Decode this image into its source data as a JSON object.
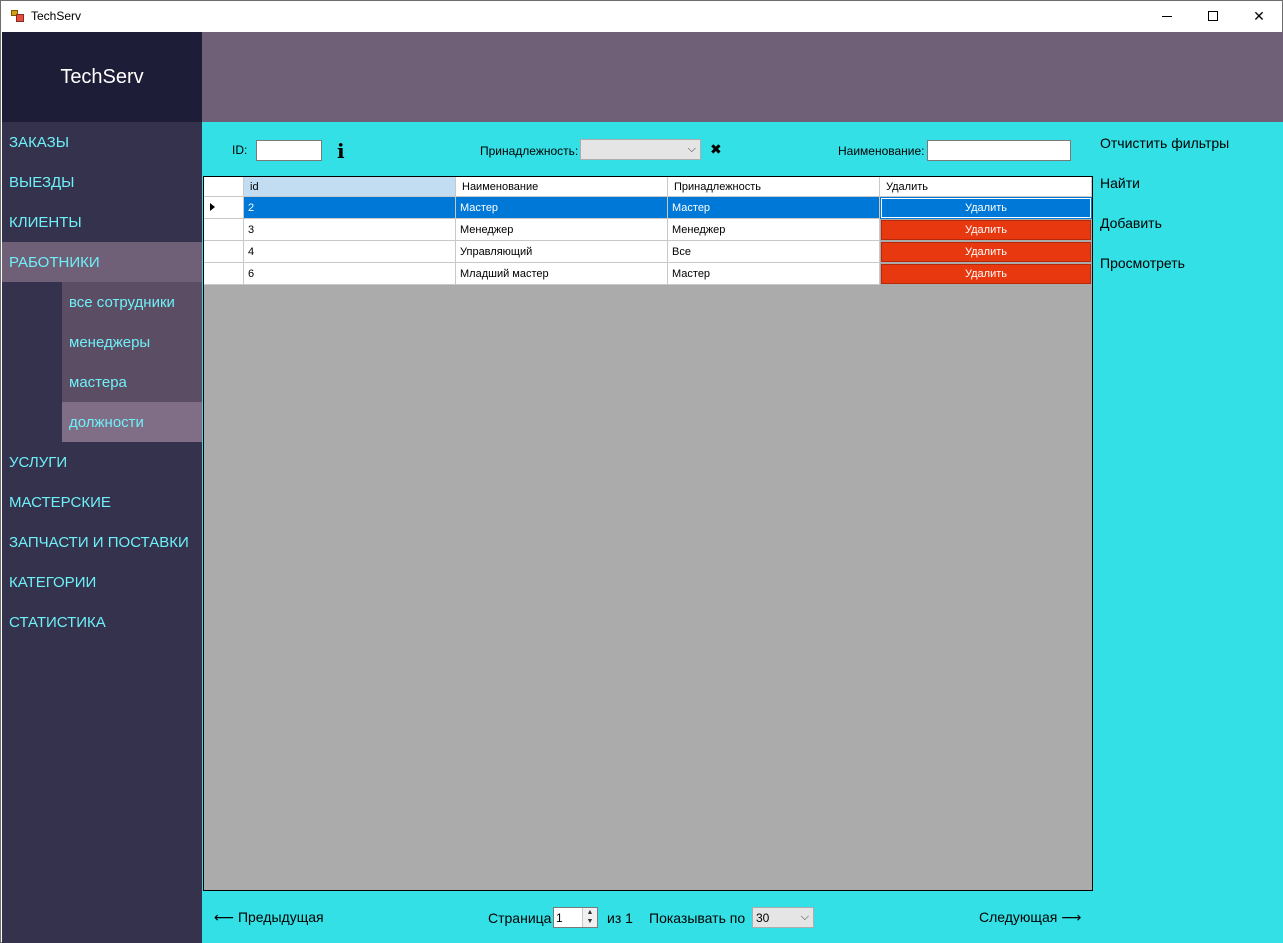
{
  "window": {
    "title": "TechServ",
    "controls": {
      "minimize": "minimize-icon",
      "maximize": "maximize-icon",
      "close": "close-icon"
    }
  },
  "sidebar": {
    "logo": "TechServ",
    "items": [
      {
        "label": "ЗАКАЗЫ",
        "active": false
      },
      {
        "label": "ВЫЕЗДЫ",
        "active": false
      },
      {
        "label": "КЛИЕНТЫ",
        "active": false
      },
      {
        "label": "РАБОТНИКИ",
        "active": true
      },
      {
        "label": "УСЛУГИ",
        "active": false
      },
      {
        "label": "МАСТЕРСКИЕ",
        "active": false
      },
      {
        "label": "ЗАПЧАСТИ И ПОСТАВКИ",
        "active": false
      },
      {
        "label": "КАТЕГОРИИ",
        "active": false
      },
      {
        "label": "СТАТИСТИКА",
        "active": false
      }
    ],
    "subitems": [
      {
        "label": "все сотрудники",
        "active": false
      },
      {
        "label": "менеджеры",
        "active": false
      },
      {
        "label": "мастера",
        "active": false
      },
      {
        "label": "должности",
        "active": true
      }
    ]
  },
  "filters": {
    "id_label": "ID:",
    "id_value": "",
    "affiliation_label": "Принадлежность:",
    "affiliation_value": "",
    "name_label": "Наименование:",
    "name_value": ""
  },
  "actions": {
    "clear_filters": "Отчистить фильтры",
    "find": "Найти",
    "add": "Добавить",
    "view": "Просмотреть"
  },
  "grid": {
    "columns": [
      "id",
      "Наименование",
      "Принадлежность",
      "Удалить"
    ],
    "rows": [
      {
        "id": "2",
        "name": "Мастер",
        "affiliation": "Мастер",
        "delete": "Удалить",
        "selected": true
      },
      {
        "id": "3",
        "name": "Менеджер",
        "affiliation": "Менеджер",
        "delete": "Удалить",
        "selected": false
      },
      {
        "id": "4",
        "name": "Управляющий",
        "affiliation": "Все",
        "delete": "Удалить",
        "selected": false
      },
      {
        "id": "6",
        "name": "Младший мастер",
        "affiliation": "Мастер",
        "delete": "Удалить",
        "selected": false
      }
    ]
  },
  "pagination": {
    "prev": "⟵ Предыдущая",
    "page_label": "Страница",
    "page_value": "1",
    "of_label": "из 1",
    "show_label": "Показывать по",
    "page_size": "30",
    "next": "Следующая ⟶"
  },
  "colors": {
    "sidebar": "#34324c",
    "logo_bg": "#1e1d38",
    "header": "#6f6078",
    "main": "#33e0e6",
    "nav_text": "#6ff0f8",
    "delete_button": "#e8380f",
    "selection": "#0078d7"
  }
}
